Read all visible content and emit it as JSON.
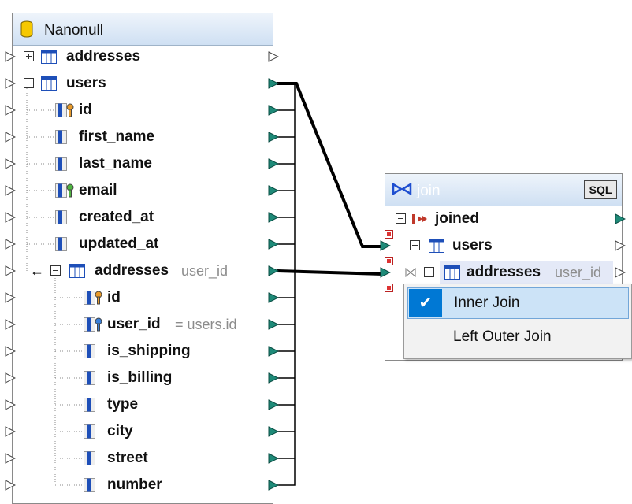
{
  "source_component": {
    "title": "Nanonull",
    "rows": [
      {
        "key": "addresses",
        "label": "addresses"
      },
      {
        "key": "users",
        "label": "users"
      },
      {
        "key": "id",
        "label": "id"
      },
      {
        "key": "first_name",
        "label": "first_name"
      },
      {
        "key": "last_name",
        "label": "last_name"
      },
      {
        "key": "email",
        "label": "email"
      },
      {
        "key": "created_at",
        "label": "created_at"
      },
      {
        "key": "updated_at",
        "label": "updated_at"
      },
      {
        "key": "addresses2",
        "label": "addresses",
        "extra": "user_id"
      },
      {
        "key": "addr_id",
        "label": "id"
      },
      {
        "key": "addr_user_id",
        "label": "user_id",
        "extra": "= users.id"
      },
      {
        "key": "is_shipping",
        "label": "is_shipping"
      },
      {
        "key": "is_billing",
        "label": "is_billing"
      },
      {
        "key": "type",
        "label": "type"
      },
      {
        "key": "city",
        "label": "city"
      },
      {
        "key": "street",
        "label": "street"
      },
      {
        "key": "number",
        "label": "number"
      }
    ]
  },
  "join_component": {
    "title": "join",
    "sql_button": "SQL",
    "rows": [
      {
        "key": "joined",
        "label": "joined"
      },
      {
        "key": "users",
        "label": "users"
      },
      {
        "key": "addresses",
        "label": "addresses",
        "extra": "user_id"
      }
    ]
  },
  "context_menu": {
    "items": [
      {
        "label": "Inner Join",
        "checked": true
      },
      {
        "label": "Left Outer Join",
        "checked": false
      }
    ]
  },
  "colors": {
    "port_fill": "#1e8a78",
    "wire": "#000000",
    "header_gradient_top": "#eef4fb",
    "header_gradient_bottom": "#cfe0f3",
    "selection_bg": "#cce3f7",
    "check_bg": "#0078d4"
  },
  "icons": {
    "db": "database-icon",
    "table": "table-icon",
    "column": "column-icon",
    "pk": "primary-key-icon",
    "fk": "foreign-key-icon",
    "unique": "unique-key-icon",
    "join": "join-icon",
    "joined": "joined-icon"
  }
}
